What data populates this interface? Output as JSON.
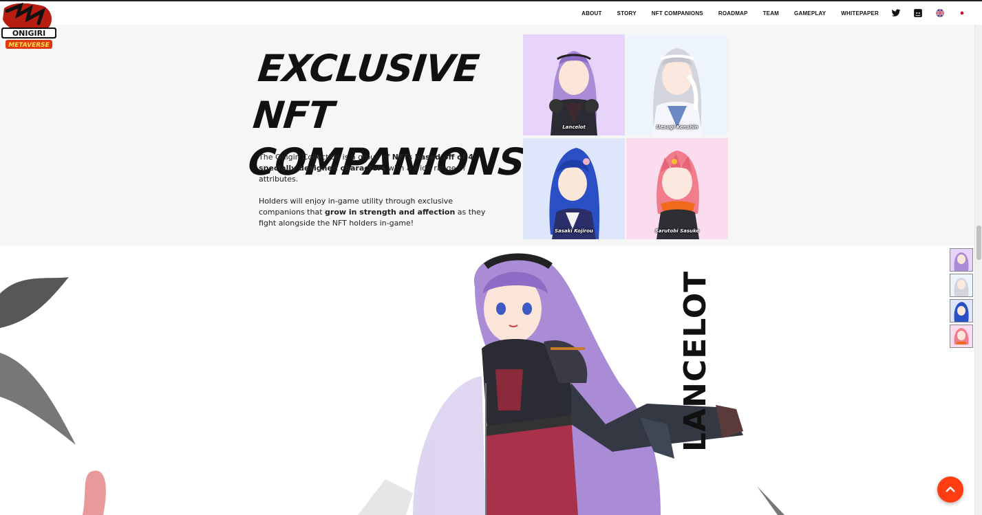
{
  "brand": {
    "logo_text_top": "鬼斬",
    "logo_text_mid": "ONIGIRI",
    "logo_text_bottom": "METAVERSE"
  },
  "nav": {
    "items": [
      "ABOUT",
      "STORY",
      "NFT COMPANIONS",
      "ROADMAP",
      "TEAM",
      "GAMEPLAY",
      "WHITEPAPER"
    ],
    "icons": [
      "twitter-icon",
      "discord-icon",
      "uk-flag-icon",
      "japan-flag-icon"
    ]
  },
  "companions": {
    "headline_line1": "EXCLUSIVE NFT",
    "headline_line2": "COMPANIONS",
    "para1_a": "The Onigiri Collection is a group of ",
    "para1_b": "NFTs based off of 4 specially designed characters",
    "para1_c": " with a wide range of attributes.",
    "para2_a": "Holders will enjoy in-game utility through exclusive companions that ",
    "para2_b": "grow in strength and affection",
    "para2_c": " as they fight alongside the NFT holders in-game!",
    "cards": [
      {
        "name": "Lancelot",
        "bg": "#e8d4fb",
        "hair": "#a98bd6"
      },
      {
        "name": "Uesugi Kenshin",
        "bg": "#eef4fb",
        "hair": "#d4d4dc"
      },
      {
        "name": "Sasaki Kojirou",
        "bg": "#dde6fb",
        "hair": "#2b4fc4"
      },
      {
        "name": "Sarutobi Sasuke",
        "bg": "#fbdcef",
        "hair": "#f07c8c"
      }
    ]
  },
  "hero": {
    "character_name": "LANCELOT"
  },
  "colors": {
    "accent": "#ff3d12",
    "section_bg": "#f6f6f6"
  }
}
